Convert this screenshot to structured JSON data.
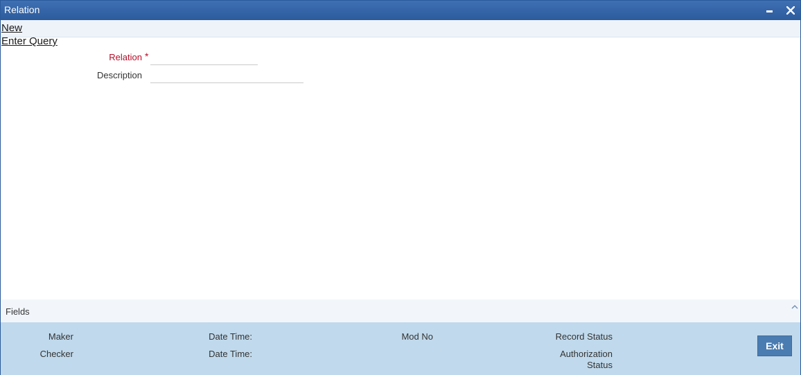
{
  "window": {
    "title": "Relation"
  },
  "actions": {
    "new_label": "New",
    "enter_query_label": "Enter Query"
  },
  "form": {
    "relation_label": "Relation",
    "required_marker": "*",
    "relation_value": "",
    "description_label": "Description",
    "description_value": ""
  },
  "fields_panel": {
    "label": "Fields"
  },
  "audit": {
    "maker_label": "Maker",
    "checker_label": "Checker",
    "date_time_label_1": "Date Time:",
    "date_time_label_2": "Date Time:",
    "mod_no_label": "Mod No",
    "record_status_label": "Record Status",
    "authorization_label_line1": "Authorization",
    "authorization_label_line2": "Status",
    "exit_label": "Exit"
  },
  "icons": {
    "minimize": "minimize-icon",
    "close": "close-icon",
    "collapse": "chevron-up-icon"
  },
  "colors": {
    "titlebar": "#3566a8",
    "required_label": "#b5102a",
    "footer": "#c0d9ec",
    "exit_button": "#4a7cb1"
  }
}
